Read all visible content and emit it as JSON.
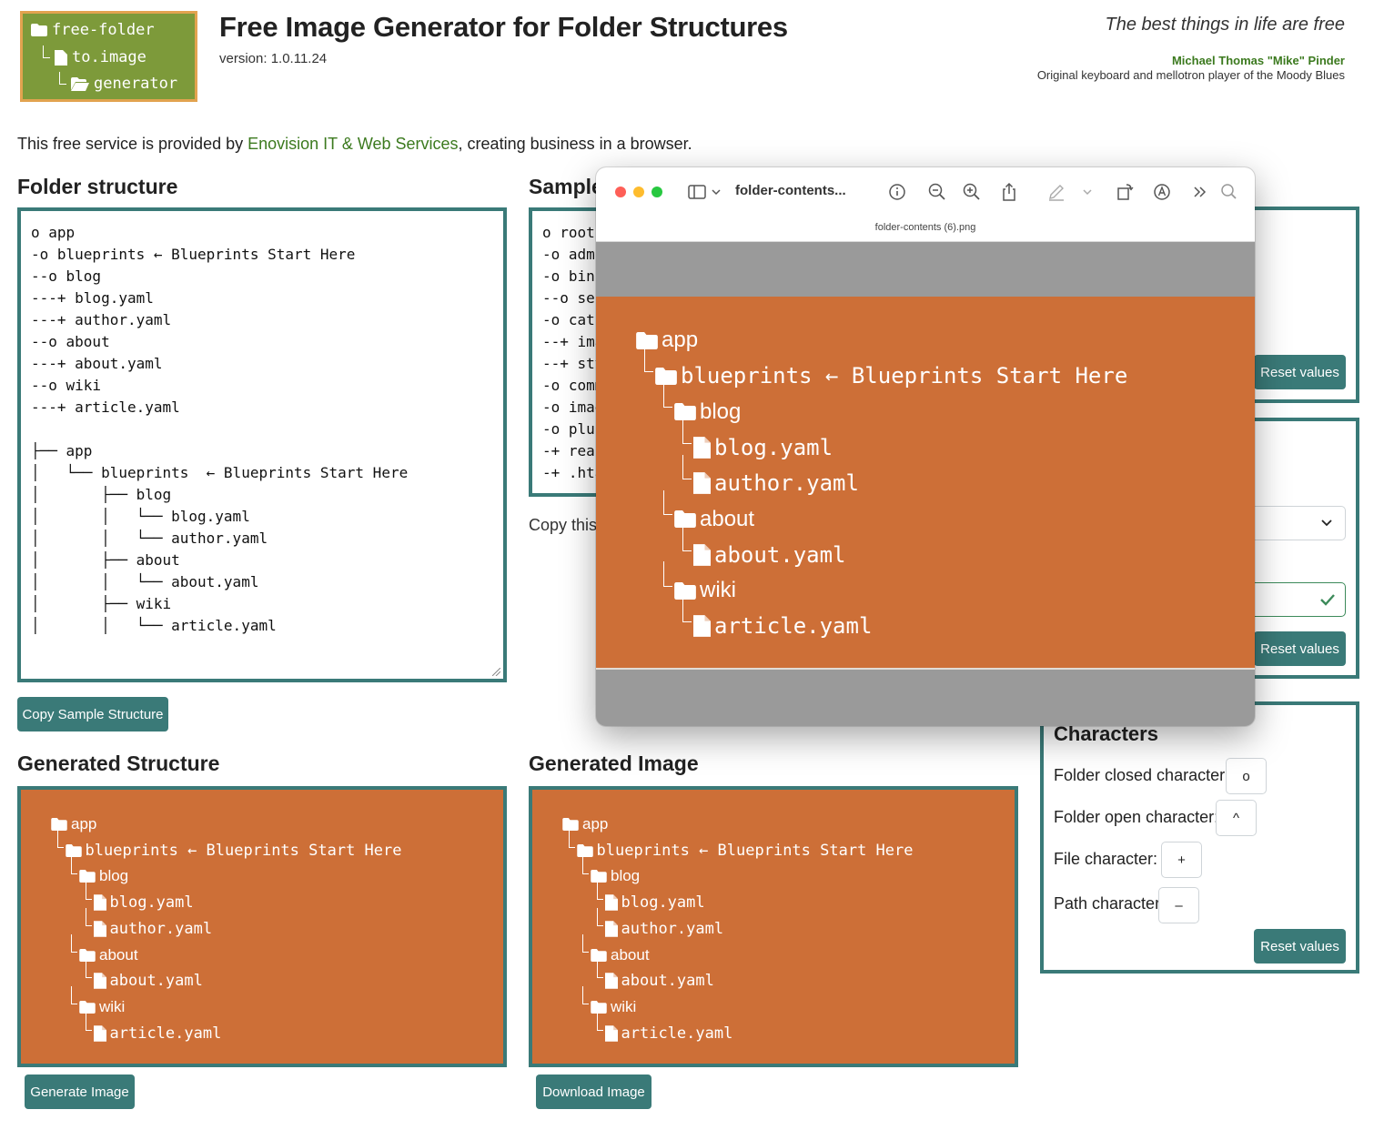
{
  "logo": {
    "line1": "free-folder",
    "line2": "to.image",
    "line3": "generator"
  },
  "header": {
    "title": "Free Image Generator for Folder Structures",
    "version": "version: 1.0.11.24",
    "quote": "The best things in life are free",
    "author": "Michael Thomas \"Mike\" Pinder",
    "author_desc": "Original keyboard and mellotron player of the Moody Blues"
  },
  "intro": {
    "before": "This free service is provided by ",
    "link": "Enovision IT & Web Services",
    "after": ", creating business in a browser."
  },
  "folder_structure": {
    "title": "Folder structure",
    "lines": [
      "o app",
      "-o blueprints ← Blueprints Start Here",
      "--o blog",
      "---+ blog.yaml",
      "---+ author.yaml",
      "--o about",
      "---+ about.yaml",
      "--o wiki",
      "---+ article.yaml",
      "",
      "├── app",
      "│   └── blueprints  ← Blueprints Start Here",
      "│       ├── blog",
      "│       │   └── blog.yaml",
      "│       │   └── author.yaml",
      "│       ├── about",
      "│       │   └── about.yaml",
      "│       ├── wiki",
      "│       │   └── article.yaml"
    ],
    "copy_button": "Copy Sample Structure"
  },
  "sample": {
    "title": "Sample",
    "lines": [
      "o root",
      "-o adm",
      "-o bin",
      "--o se",
      "-o cat",
      "--+ ima",
      "--+ sty",
      "-o comm",
      "-o imag",
      "-o plu",
      "-+ rea",
      "-+ .hta"
    ],
    "copy_hint": "Copy this s"
  },
  "tree": [
    {
      "type": "folder",
      "label": "app"
    },
    {
      "type": "folder",
      "label": "blueprints ← Blueprints Start Here"
    },
    {
      "type": "folder",
      "label": "blog"
    },
    {
      "type": "file",
      "label": "blog.yaml"
    },
    {
      "type": "file",
      "label": "author.yaml"
    },
    {
      "type": "folder",
      "label": "about"
    },
    {
      "type": "file",
      "label": "about.yaml"
    },
    {
      "type": "folder",
      "label": "wiki"
    },
    {
      "type": "file",
      "label": "article.yaml"
    }
  ],
  "generated_structure": {
    "title": "Generated Structure",
    "button": "Generate Image"
  },
  "generated_image": {
    "title": "Generated Image",
    "button": "Download Image"
  },
  "preview_window": {
    "title": "folder-contents...",
    "filename": "folder-contents (6).png"
  },
  "right_panel": {
    "reset_label": "Reset values"
  },
  "characters": {
    "title": "Characters",
    "folder_closed_label": "Folder closed character:",
    "folder_closed_value": "o",
    "folder_open_label": "Folder open character:",
    "folder_open_value": "^",
    "file_label": "File character:",
    "file_value": "+",
    "path_label": "Path character:",
    "path_value": "–",
    "reset_label": "Reset values"
  },
  "colors": {
    "teal": "#3a7a78",
    "orange": "#cd6f37",
    "logo_green": "#7d9a3a",
    "link_green": "#3c7a1f"
  }
}
